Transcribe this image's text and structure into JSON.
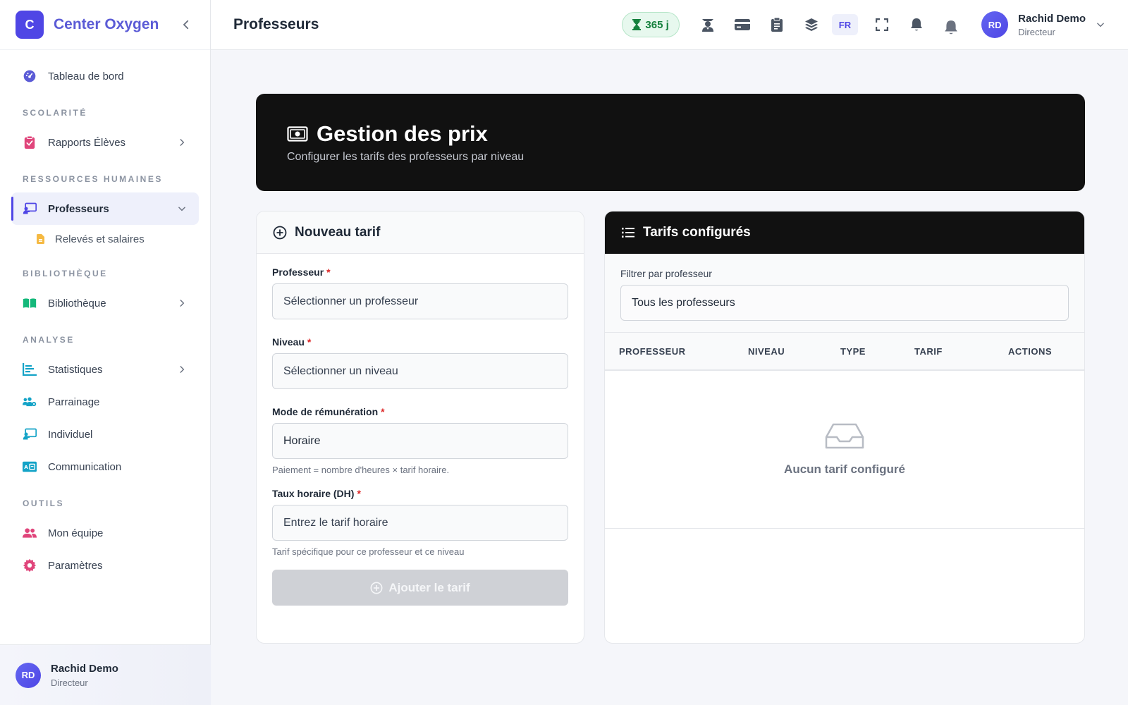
{
  "brand": {
    "logo_letter": "C",
    "name": "Center Oxygen"
  },
  "sidebar": {
    "dashboard": {
      "label": "Tableau de bord",
      "icon": "dashboard-icon"
    },
    "sections": [
      {
        "title": "SCOLARITÉ"
      },
      {
        "title": "RESSOURCES HUMAINES"
      },
      {
        "title": "BIBLIOTHÈQUE"
      },
      {
        "title": "ANALYSE"
      },
      {
        "title": "OUTILS"
      }
    ],
    "items": {
      "rapports": {
        "label": "Rapports Élèves",
        "icon": "clipboard-check-icon"
      },
      "professeurs": {
        "label": "Professeurs",
        "icon": "chalkboard-teacher-icon"
      },
      "releves": {
        "label": "Relevés et salaires",
        "icon": "file-invoice-icon"
      },
      "bibliotheque": {
        "label": "Bibliothèque",
        "icon": "book-open-icon"
      },
      "statistiques": {
        "label": "Statistiques",
        "icon": "chart-bar-icon"
      },
      "parrainage": {
        "label": "Parrainage",
        "icon": "users-cog-icon"
      },
      "individuel": {
        "label": "Individuel",
        "icon": "chalkboard-teacher-icon"
      },
      "communication": {
        "label": "Communication",
        "icon": "id-card-icon"
      },
      "equipe": {
        "label": "Mon équipe",
        "icon": "users-icon"
      },
      "parametres": {
        "label": "Paramètres",
        "icon": "gear-icon"
      }
    },
    "user": {
      "initials": "RD",
      "name": "Rachid Demo",
      "role": "Directeur"
    }
  },
  "topbar": {
    "title": "Professeurs",
    "days_badge": "365 j",
    "lang": "FR",
    "user": {
      "initials": "RD",
      "name": "Rachid Demo",
      "role": "Directeur"
    }
  },
  "hero": {
    "title": "Gestion des prix",
    "subtitle": "Configurer les tarifs des professeurs par niveau"
  },
  "form": {
    "title": "Nouveau tarif",
    "professeur": {
      "label": "Professeur",
      "value": "Sélectionner un professeur"
    },
    "niveau": {
      "label": "Niveau",
      "value": "Sélectionner un niveau"
    },
    "mode": {
      "label": "Mode de rémunération",
      "value": "Horaire",
      "hint": "Paiement = nombre d'heures × tarif horaire."
    },
    "taux": {
      "label": "Taux horaire (DH)",
      "placeholder": "Entrez le tarif horaire",
      "hint": "Tarif spécifique pour ce professeur et ce niveau"
    },
    "submit": "Ajouter le tarif",
    "required_mark": "*"
  },
  "tarifs": {
    "title": "Tarifs configurés",
    "filter_label": "Filtrer par professeur",
    "filter_value": "Tous les professeurs",
    "columns": [
      "PROFESSEUR",
      "NIVEAU",
      "TYPE",
      "TARIF",
      "ACTIONS"
    ],
    "empty": "Aucun tarif configuré"
  },
  "colors": {
    "accent": "#4f46e5",
    "dark": "#111111",
    "success": "#15803d"
  }
}
